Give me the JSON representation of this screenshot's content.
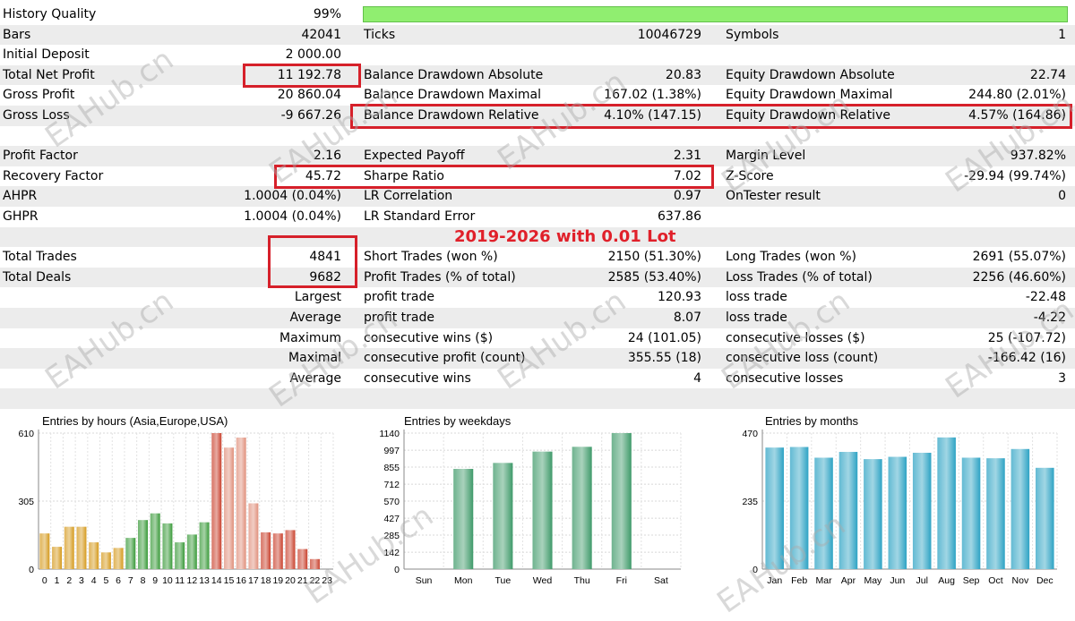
{
  "rows": [
    {
      "l1": "History Quality",
      "v1": "99%",
      "l2": "",
      "v2": "",
      "l3": "",
      "v3": ""
    },
    {
      "l1": "Bars",
      "v1": "42041",
      "l2": "Ticks",
      "v2": "10046729",
      "l3": "Symbols",
      "v3": "1"
    },
    {
      "l1": "Initial Deposit",
      "v1": "2 000.00",
      "l2": "",
      "v2": "",
      "l3": "",
      "v3": ""
    },
    {
      "l1": "Total Net Profit",
      "v1": "11 192.78",
      "l2": "Balance Drawdown Absolute",
      "v2": "20.83",
      "l3": "Equity Drawdown Absolute",
      "v3": "22.74"
    },
    {
      "l1": "Gross Profit",
      "v1": "20 860.04",
      "l2": "Balance Drawdown Maximal",
      "v2": "167.02 (1.38%)",
      "l3": "Equity Drawdown Maximal",
      "v3": "244.80 (2.01%)"
    },
    {
      "l1": "Gross Loss",
      "v1": "-9 667.26",
      "l2": "Balance Drawdown Relative",
      "v2": "4.10% (147.15)",
      "l3": "Equity Drawdown Relative",
      "v3": "4.57% (164.86)"
    },
    {
      "l1": "",
      "v1": "",
      "l2": "",
      "v2": "",
      "l3": "",
      "v3": ""
    },
    {
      "l1": "Profit Factor",
      "v1": "2.16",
      "l2": "Expected Payoff",
      "v2": "2.31",
      "l3": "Margin Level",
      "v3": "937.82%"
    },
    {
      "l1": "Recovery Factor",
      "v1": "45.72",
      "l2": "Sharpe Ratio",
      "v2": "7.02",
      "l3": "Z-Score",
      "v3": "-29.94 (99.74%)"
    },
    {
      "l1": "AHPR",
      "v1": "1.0004 (0.04%)",
      "l2": "LR Correlation",
      "v2": "0.97",
      "l3": "OnTester result",
      "v3": "0"
    },
    {
      "l1": "GHPR",
      "v1": "1.0004 (0.04%)",
      "l2": "LR Standard Error",
      "v2": "637.86",
      "l3": "",
      "v3": ""
    },
    {
      "l1": "",
      "v1": "",
      "l2": "",
      "v2": "",
      "l3": "",
      "v3": ""
    },
    {
      "l1": "Total Trades",
      "v1": "4841",
      "l2": "Short Trades (won %)",
      "v2": "2150 (51.30%)",
      "l3": "Long Trades (won %)",
      "v3": "2691 (55.07%)"
    },
    {
      "l1": "Total Deals",
      "v1": "9682",
      "l2": "Profit Trades (% of total)",
      "v2": "2585 (53.40%)",
      "l3": "Loss Trades (% of total)",
      "v3": "2256 (46.60%)"
    },
    {
      "l1": "",
      "v1": "Largest",
      "l2": "profit trade",
      "v2": "120.93",
      "l3": "loss trade",
      "v3": "-22.48"
    },
    {
      "l1": "",
      "v1": "Average",
      "l2": "profit trade",
      "v2": "8.07",
      "l3": "loss trade",
      "v3": "-4.22"
    },
    {
      "l1": "",
      "v1": "Maximum",
      "l2": "consecutive wins ($)",
      "v2": "24 (101.05)",
      "l3": "consecutive losses ($)",
      "v3": "25 (-107.72)"
    },
    {
      "l1": "",
      "v1": "Maximal",
      "l2": "consecutive profit (count)",
      "v2": "355.55 (18)",
      "l3": "consecutive loss (count)",
      "v3": "-166.42 (16)"
    },
    {
      "l1": "",
      "v1": "Average",
      "l2": "consecutive wins",
      "v2": "4",
      "l3": "consecutive losses",
      "v3": "3"
    },
    {
      "l1": "",
      "v1": "",
      "l2": "",
      "v2": "",
      "l3": "",
      "v3": ""
    }
  ],
  "banner": "2019-2026 with 0.01 Lot",
  "watermark": "EAHub.cn",
  "colors": {
    "highlight": "#d6202a",
    "quality_bar": "#90ee70",
    "banner": "#e0202a"
  },
  "chart_data": [
    {
      "type": "bar",
      "title": "Entries by hours (Asia,Europe,USA)",
      "categories": [
        "0",
        "1",
        "2",
        "3",
        "4",
        "5",
        "6",
        "7",
        "8",
        "9",
        "10",
        "11",
        "12",
        "13",
        "14",
        "15",
        "16",
        "17",
        "18",
        "19",
        "20",
        "21",
        "22",
        "23"
      ],
      "values": [
        160,
        100,
        190,
        190,
        120,
        75,
        95,
        140,
        220,
        250,
        205,
        120,
        155,
        210,
        610,
        545,
        590,
        295,
        165,
        160,
        175,
        90,
        45,
        0
      ],
      "yticks": [
        "0",
        "305",
        "610"
      ],
      "ylim": [
        0,
        610
      ],
      "colors": [
        "#d59a1e",
        "#d59a1e",
        "#d59a1e",
        "#d59a1e",
        "#d59a1e",
        "#d59a1e",
        "#d59a1e",
        "#3a9a3a",
        "#3a9a3a",
        "#3a9a3a",
        "#3a9a3a",
        "#3a9a3a",
        "#3a9a3a",
        "#3a9a3a",
        "#c9422e",
        "#e0907c",
        "#e0907c",
        "#e0907c",
        "#c9422e",
        "#c9422e",
        "#c9422e",
        "#c9422e",
        "#c9422e",
        "#d59a1e"
      ]
    },
    {
      "type": "bar",
      "title": "Entries by weekdays",
      "categories": [
        "Sun",
        "Mon",
        "Tue",
        "Wed",
        "Thu",
        "Fri",
        "Sat"
      ],
      "values": [
        0,
        840,
        890,
        985,
        1025,
        1140,
        0
      ],
      "yticks": [
        "0",
        "142",
        "285",
        "427",
        "570",
        "712",
        "855",
        "997",
        "1140"
      ],
      "ylim": [
        0,
        1140
      ],
      "colors": [
        "#3f9a6a"
      ]
    },
    {
      "type": "bar",
      "title": "Entries by months",
      "categories": [
        "Jan",
        "Feb",
        "Mar",
        "Apr",
        "May",
        "Jun",
        "Jul",
        "Aug",
        "Sep",
        "Oct",
        "Nov",
        "Dec"
      ],
      "values": [
        420,
        422,
        385,
        405,
        380,
        388,
        402,
        455,
        385,
        383,
        415,
        350
      ],
      "yticks": [
        "0",
        "235",
        "470"
      ],
      "ylim": [
        0,
        470
      ],
      "colors": [
        "#2ea3c4"
      ]
    }
  ]
}
